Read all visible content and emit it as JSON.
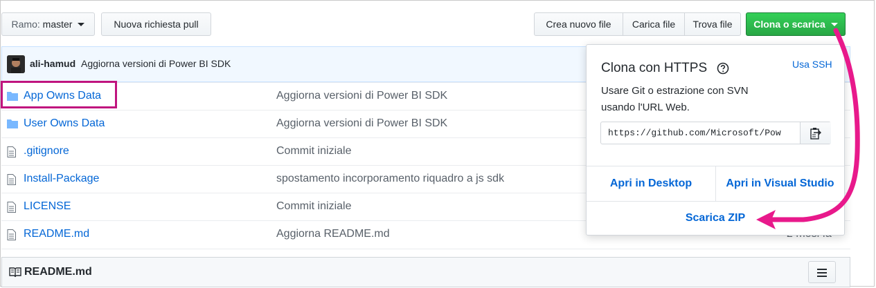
{
  "toolbar": {
    "branch_prefix": "Ramo:",
    "branch_name": "master",
    "new_pull_request": "Nuova richiesta pull",
    "create_file": "Crea nuovo file",
    "upload_file": "Carica file",
    "find_file": "Trova file",
    "clone_download": "Clona o scarica"
  },
  "commit": {
    "author": "ali-hamud",
    "message": "Aggiorna versioni di Power BI SDK"
  },
  "files": [
    {
      "name": "App Owns Data",
      "type": "folder",
      "message": "Aggiorna versioni di Power BI SDK"
    },
    {
      "name": "User Owns Data",
      "type": "folder",
      "message": "Aggiorna versioni di Power BI SDK"
    },
    {
      "name": ".gitignore",
      "type": "file",
      "message": "Commit iniziale"
    },
    {
      "name": "Install-Package",
      "type": "file",
      "message": "spostamento incorporamento riquadro a js sdk"
    },
    {
      "name": "LICENSE",
      "type": "file",
      "message": "Commit iniziale"
    },
    {
      "name": "README.md",
      "type": "file",
      "message": "Aggiorna README.md",
      "age": "2 mesi fa"
    }
  ],
  "clone_popup": {
    "title": "Clona con HTTPS",
    "use_ssh": "Usa SSH",
    "description": "Usare Git o estrazione con SVN usando l'URL Web.",
    "url": "https://github.com/Microsoft/Pow",
    "open_desktop": "Apri in Desktop",
    "open_visual_studio": "Apri in Visual Studio",
    "download_zip": "Scarica ZIP"
  },
  "readme": {
    "title": "README.md"
  },
  "colors": {
    "highlight": "#c0147e",
    "arrow": "#e8198b",
    "link": "#0366d6",
    "green": "#28a745"
  }
}
